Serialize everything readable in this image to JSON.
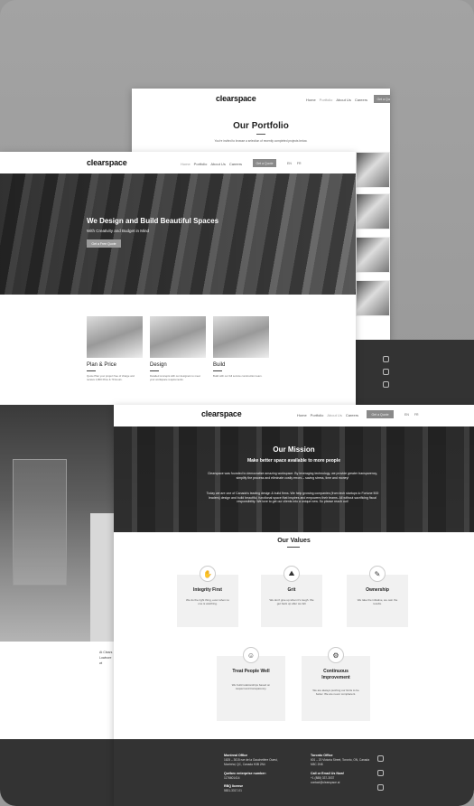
{
  "brand": {
    "logo": "clearspace"
  },
  "nav": {
    "home": "Home",
    "portfolio": "Portfolio",
    "about": "About Us",
    "careers": "Careers",
    "cta": "Get a Quote",
    "lang_en": "EN",
    "lang_fr": "FR"
  },
  "portfolio_page": {
    "title": "Our Portfolio",
    "subtitle": "You're invited to browse a selection of recently completed projects below."
  },
  "home_page": {
    "hero_title": "We Design and Build Beautiful Spaces",
    "hero_subtitle": "With Creativity and Budget in Mind",
    "hero_button": "Get a Free Quote",
    "services": [
      {
        "title": "Plan & Price",
        "desc": "Quote Plan your project free of charge and receive 1,800 Price & 70 Hours."
      },
      {
        "title": "Design",
        "desc": "Detailed concepts with our designers to meet your workspace requirements."
      },
      {
        "title": "Build",
        "desc": "Build with our full service construction team."
      }
    ]
  },
  "about_page": {
    "mission_title": "Our Mission",
    "mission_subtitle": "Make better space available to more people",
    "mission_p1": "Clearspace was founded to democratize amazing workspace. By leveraging technology, we provide greater transparency, simplify the process and eliminate costly errors – saving stress, time and money!",
    "mission_p2": "Today we are one of Canada's leading design & build firms. We help growing companies (from tech startups to Fortune 500 leaders) design and build beautiful, functional space that inspires and empowers their teams. All without sacrificing fiscal responsibility. We love to get our clients into a unique new. So please reach out!",
    "values_title": "Our Values",
    "values": [
      {
        "name": "Integrity First",
        "desc": "We do the right thing, even when no one is watching.",
        "icon": "✋"
      },
      {
        "name": "Grit",
        "desc": "We don't give up when it's tough. We get back up after we fall.",
        "icon": "⛰"
      },
      {
        "name": "Ownership",
        "desc": "We take the initiative, we own the results.",
        "icon": "✎"
      },
      {
        "name": "Treat People Well",
        "desc": "We build relationships based on respect and transparency.",
        "icon": "☺"
      },
      {
        "name": "Continuous Improvement",
        "desc": "We are always pushing our limits to be better. We are never complacent.",
        "icon": "⚙"
      }
    ],
    "footer": {
      "montreal_label": "Montreal Office",
      "montreal_addr": "1625 – 3015 rue de la Gauchetière Ouest, Montréal, QC, Canada H3B 2N4",
      "quebec_label": "Québec enterprise number:",
      "quebec_num": "1176601414",
      "rbq_label": "RBQ license",
      "rbq_num": "5831-3317-01",
      "toronto_label": "Toronto Office",
      "toronto_addr": "601 – 20 Victoria Street, Toronto, ON, Canada M5C 2N8",
      "call_label": "Call or Email Us Now!",
      "phone": "+1 (888) 337-3037",
      "email": "contact@clearspace.ai"
    }
  },
  "left_fragment": {
    "line1": "At Clears",
    "line2": "Lowbore",
    "line3": "wi"
  }
}
